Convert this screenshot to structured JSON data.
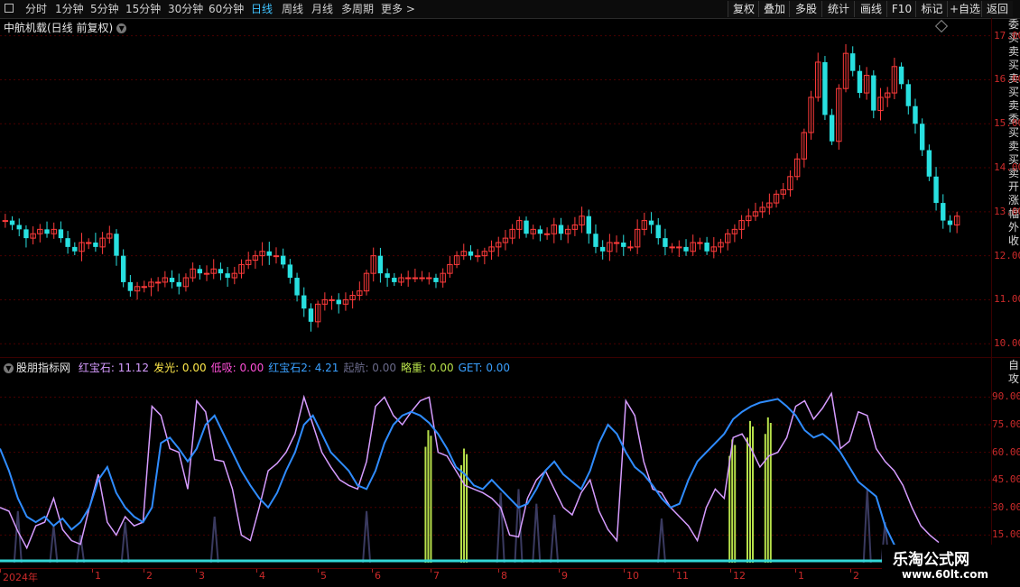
{
  "toolbar": {
    "tabs": [
      "分时",
      "1分钟",
      "5分钟",
      "15分钟",
      "30分钟",
      "60分钟",
      "日线",
      "周线",
      "月线",
      "多周期",
      "更多 >"
    ],
    "active_tab": "日线",
    "right_buttons": [
      "复权",
      "叠加",
      "多股",
      "统计",
      "画线",
      "F10",
      "标记",
      "+自选",
      "返回"
    ]
  },
  "main_chart": {
    "title": "中航机载(日线 前复权)",
    "y_ticks": [
      "17.00",
      "16.00",
      "15.00",
      "14.00",
      "13.00",
      "12.00",
      "11.00",
      "10.00"
    ],
    "side_text": "委买卖买卖买卖委买卖买卖开涨幅外收"
  },
  "indicator": {
    "name": "股朋指标网",
    "items": [
      {
        "label": "红宝石: 11.12",
        "color": "#d69cff"
      },
      {
        "label": "发光: 0.00",
        "color": "#ffe94a"
      },
      {
        "label": "低吸: 0.00",
        "color": "#ff4fd8"
      },
      {
        "label": "红宝石2: 4.21",
        "color": "#3aa0ff"
      },
      {
        "label": "起航: 0.00",
        "color": "#6a6a8a"
      },
      {
        "label": "略重: 0.00",
        "color": "#b7e04a"
      },
      {
        "label": "GET: 0.00",
        "color": "#3aa0ff"
      }
    ],
    "y_ticks": [
      "90.00",
      "75.00",
      "60.00",
      "45.00",
      "30.00",
      "15.00"
    ],
    "side_text": "自攻"
  },
  "x_axis": {
    "labels": [
      "2024年",
      "1",
      "2",
      "3",
      "4",
      "5",
      "6",
      "7",
      "8",
      "9",
      "10",
      "11",
      "12",
      "1",
      "2"
    ]
  },
  "watermark": {
    "line1": "乐淘公式网",
    "line2": "www.60lt.com"
  },
  "colors": {
    "up": "#ff3b3b",
    "down": "#28e0e0",
    "axis": "#cc2a2a",
    "line1": "#d69cff",
    "line2": "#2f8cff",
    "bar": "#b7e04a",
    "spike": "#2a2a44"
  },
  "chart_data": [
    {
      "type": "candlestick",
      "title": "中航机载(日线 前复权)",
      "ylim": [
        9.8,
        17.3
      ],
      "yticks": [
        10,
        11,
        12,
        13,
        14,
        15,
        16,
        17
      ],
      "close": [
        12.8,
        12.7,
        12.6,
        12.4,
        12.5,
        12.6,
        12.5,
        12.6,
        12.4,
        12.2,
        12.1,
        12.3,
        12.3,
        12.2,
        12.4,
        12.5,
        12.0,
        11.4,
        11.2,
        11.3,
        11.3,
        11.4,
        11.4,
        11.5,
        11.4,
        11.3,
        11.5,
        11.7,
        11.6,
        11.6,
        11.7,
        11.6,
        11.5,
        11.6,
        11.8,
        11.9,
        12.0,
        12.1,
        12.0,
        12.0,
        11.8,
        11.5,
        11.1,
        10.8,
        10.5,
        10.9,
        11.0,
        11.0,
        10.9,
        11.0,
        11.1,
        11.2,
        11.6,
        12.0,
        11.6,
        11.5,
        11.4,
        11.5,
        11.5,
        11.5,
        11.5,
        11.5,
        11.4,
        11.6,
        11.8,
        12.0,
        12.1,
        12.0,
        12.0,
        12.1,
        12.2,
        12.3,
        12.4,
        12.6,
        12.8,
        12.5,
        12.6,
        12.5,
        12.5,
        12.7,
        12.5,
        12.6,
        12.7,
        12.9,
        12.5,
        12.2,
        12.1,
        12.3,
        12.3,
        12.2,
        12.2,
        12.6,
        12.8,
        12.7,
        12.4,
        12.2,
        12.2,
        12.2,
        12.1,
        12.3,
        12.3,
        12.1,
        12.2,
        12.3,
        12.5,
        12.6,
        12.8,
        12.9,
        13.0,
        13.1,
        13.2,
        13.4,
        13.5,
        13.8,
        14.2,
        14.8,
        15.6,
        16.4,
        15.2,
        14.6,
        15.8,
        16.6,
        16.2,
        15.7,
        16.1,
        15.3,
        15.6,
        15.7,
        16.3,
        15.9,
        15.4,
        15.0,
        14.4,
        13.8,
        13.2,
        12.8,
        12.7,
        12.9
      ]
    },
    {
      "type": "line",
      "title": "股朋指标网",
      "ylim": [
        0,
        100
      ],
      "yticks": [
        15,
        30,
        45,
        60,
        75,
        90
      ],
      "series": [
        {
          "name": "红宝石",
          "values": [
            30,
            28,
            17,
            8,
            20,
            22,
            35,
            18,
            12,
            10,
            30,
            48,
            22,
            15,
            25,
            20,
            22,
            85,
            80,
            62,
            60,
            40,
            88,
            82,
            56,
            55,
            40,
            15,
            12,
            30,
            50,
            54,
            60,
            70,
            90,
            75,
            60,
            52,
            45,
            42,
            40,
            55,
            85,
            90,
            80,
            75,
            82,
            88,
            90,
            60,
            58,
            50,
            42,
            40,
            38,
            35,
            30,
            15,
            14,
            35,
            45,
            50,
            40,
            30,
            26,
            38,
            45,
            28,
            18,
            12,
            88,
            80,
            55,
            40,
            38,
            30,
            25,
            20,
            12,
            30,
            40,
            35,
            68,
            70,
            62,
            52,
            58,
            60,
            68,
            85,
            88,
            78,
            84,
            92,
            62,
            66,
            82,
            80,
            62,
            55,
            50,
            42,
            30,
            20,
            15,
            11
          ]
        },
        {
          "name": "红宝石2",
          "values": [
            62,
            50,
            35,
            25,
            22,
            25,
            20,
            24,
            18,
            22,
            30,
            45,
            52,
            38,
            30,
            25,
            22,
            30,
            65,
            68,
            62,
            55,
            62,
            75,
            80,
            70,
            60,
            50,
            42,
            35,
            30,
            38,
            50,
            60,
            75,
            80,
            70,
            60,
            55,
            50,
            42,
            40,
            50,
            65,
            75,
            80,
            82,
            80,
            76,
            70,
            62,
            52,
            48,
            42,
            40,
            45,
            40,
            35,
            30,
            32,
            40,
            50,
            55,
            48,
            44,
            40,
            50,
            65,
            75,
            70,
            60,
            52,
            48,
            42,
            35,
            30,
            32,
            45,
            55,
            60,
            65,
            70,
            78,
            82,
            85,
            87,
            88,
            89,
            85,
            80,
            72,
            68,
            70,
            66,
            60,
            52,
            44,
            40,
            36,
            20,
            10,
            4
          ]
        },
        {
          "name": "略重",
          "values": [
            0,
            0,
            0,
            0,
            0,
            0,
            0,
            0,
            0,
            0,
            0,
            0,
            0,
            0,
            0,
            0,
            0,
            0,
            0,
            0,
            0,
            0,
            0,
            0,
            0,
            0,
            0,
            0,
            0,
            0,
            0,
            0,
            0,
            0,
            0,
            0,
            0,
            0,
            0,
            0,
            0,
            0,
            0,
            0,
            0,
            0,
            0,
            0,
            75,
            0,
            0,
            0,
            65,
            0,
            0,
            0,
            0,
            0,
            0,
            0,
            0,
            0,
            0,
            0,
            0,
            0,
            0,
            0,
            0,
            0,
            0,
            0,
            0,
            0,
            0,
            0,
            0,
            0,
            0,
            0,
            0,
            0,
            70,
            0,
            80,
            0,
            82,
            0,
            0,
            0,
            0,
            0,
            0,
            0,
            0,
            0,
            0,
            0,
            0,
            0,
            0,
            0
          ]
        },
        {
          "name": "起航",
          "values": [
            0,
            0,
            28,
            0,
            0,
            0,
            20,
            0,
            0,
            15,
            0,
            0,
            0,
            0,
            22,
            0,
            0,
            0,
            0,
            0,
            0,
            0,
            0,
            0,
            25,
            0,
            0,
            0,
            0,
            0,
            0,
            0,
            0,
            0,
            0,
            0,
            0,
            0,
            0,
            0,
            0,
            28,
            0,
            0,
            0,
            0,
            0,
            0,
            0,
            0,
            0,
            0,
            0,
            0,
            0,
            0,
            38,
            0,
            40,
            0,
            32,
            0,
            26,
            0,
            0,
            0,
            0,
            0,
            0,
            0,
            0,
            0,
            0,
            0,
            24,
            0,
            0,
            0,
            0,
            0,
            0,
            0,
            0,
            0,
            0,
            0,
            0,
            0,
            0,
            0,
            0,
            0,
            0,
            0,
            0,
            0,
            0,
            40,
            0,
            22,
            0,
            0
          ]
        },
        {
          "name": "GET",
          "values": [
            2,
            2,
            2,
            2,
            2,
            2,
            2,
            2,
            2,
            2,
            2,
            2,
            2,
            2,
            2,
            2,
            2,
            2,
            2,
            2,
            2,
            2,
            2,
            2,
            2,
            2,
            2,
            2,
            2,
            2,
            2,
            2,
            2,
            2,
            2,
            2,
            2,
            2,
            2,
            2,
            2,
            2,
            2,
            2,
            2,
            2,
            2,
            2,
            2,
            2,
            2,
            2,
            2,
            2,
            2,
            2,
            2,
            2,
            2,
            2,
            2,
            2,
            2,
            2,
            2,
            2,
            2,
            2,
            2,
            2,
            2,
            2,
            2,
            2,
            2,
            2,
            2,
            2,
            2,
            2,
            2,
            2,
            2,
            2,
            2,
            2,
            2,
            2,
            2,
            2,
            2,
            2,
            2,
            2,
            2,
            2,
            2,
            2,
            2,
            2,
            2,
            2
          ]
        }
      ]
    }
  ]
}
